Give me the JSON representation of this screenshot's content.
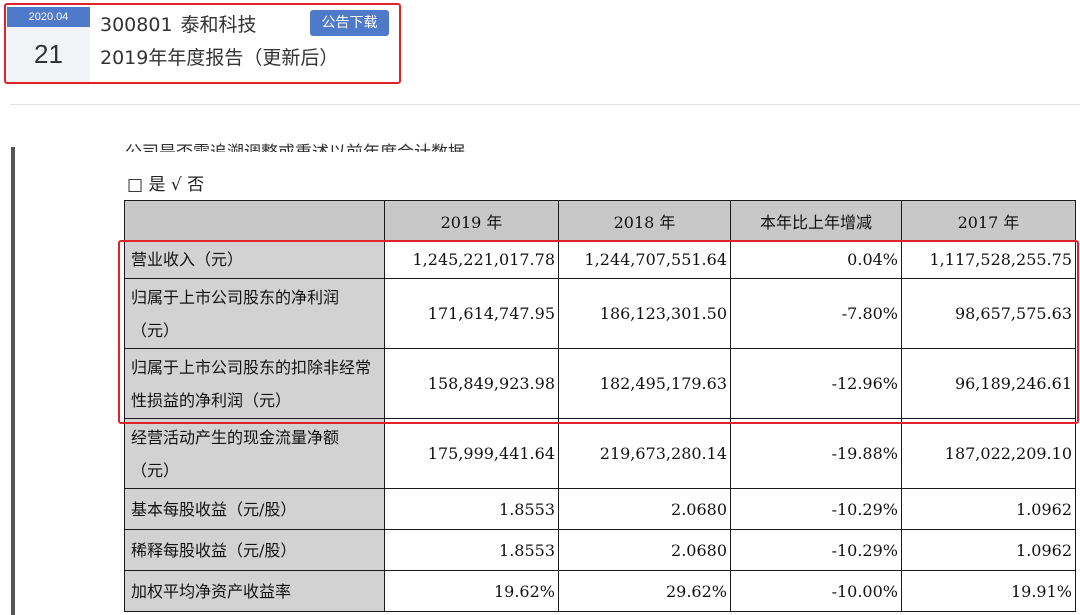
{
  "announcement": {
    "date_month": "2020.04",
    "date_day": "21",
    "stock_code": "300801",
    "company_name": "泰和科技",
    "download_label": "公告下载",
    "report_title": "2019年年度报告（更新后）"
  },
  "document": {
    "cut_line": "公司是否需追溯调整或重述以前年度会计数据",
    "yes_no": "□ 是 √ 否",
    "columns": [
      "",
      "2019 年",
      "2018 年",
      "本年比上年增减",
      "2017 年"
    ],
    "rows": [
      {
        "label": "营业收入（元）",
        "values": [
          "1,245,221,017.78",
          "1,244,707,551.64",
          "0.04%",
          "1,117,528,255.75"
        ]
      },
      {
        "label": "归属于上市公司股东的净利润（元）",
        "values": [
          "171,614,747.95",
          "186,123,301.50",
          "-7.80%",
          "98,657,575.63"
        ]
      },
      {
        "label": "归属于上市公司股东的扣除非经常性损益的净利润（元）",
        "values": [
          "158,849,923.98",
          "182,495,179.63",
          "-12.96%",
          "96,189,246.61"
        ]
      },
      {
        "label": "经营活动产生的现金流量净额（元）",
        "values": [
          "175,999,441.64",
          "219,673,280.14",
          "-19.88%",
          "187,022,209.10"
        ]
      },
      {
        "label": "基本每股收益（元/股）",
        "values": [
          "1.8553",
          "2.0680",
          "-10.29%",
          "1.0962"
        ]
      },
      {
        "label": "稀释每股收益（元/股）",
        "values": [
          "1.8553",
          "2.0680",
          "-10.29%",
          "1.0962"
        ]
      },
      {
        "label": "加权平均净资产收益率",
        "values": [
          "19.62%",
          "29.62%",
          "-10.00%",
          "19.91%"
        ]
      }
    ]
  }
}
